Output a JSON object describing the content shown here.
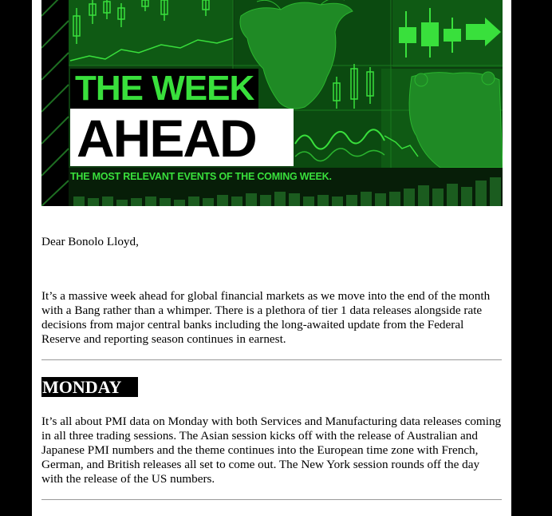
{
  "banner": {
    "title_line1": "THE WEEK",
    "title_line2": "AHEAD",
    "subtitle": "THE MOST RELEVANT EVENTS OF THE COMING WEEK.",
    "colors": {
      "green": "#39e03c",
      "dark_green": "#0d3d10",
      "panel_green": "#0f5a14"
    }
  },
  "greeting": "Dear Bonolo Lloyd,",
  "intro": "It’s a massive week ahead for global financial markets as we move into the end of the month with a Bang rather than a whimper. There is a plethora of tier 1 data releases alongside rate decisions from major central banks including the long-awaited update from the Federal Reserve and reporting season continues in earnest.",
  "sections": [
    {
      "day": "MONDAY",
      "body": "It’s all about PMI data on Monday with both Services and Manufacturing data releases coming in all three trading sessions. The Asian session kicks off with the release of Australian and Japanese PMI numbers and the theme continues into the European time zone with French, German, and British releases all set to come out. The New York session rounds off the day with the release of the US numbers."
    }
  ]
}
